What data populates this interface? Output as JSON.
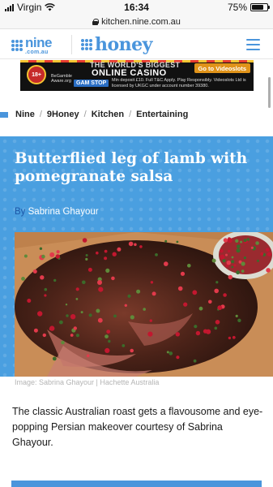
{
  "status_bar": {
    "carrier": "Virgin",
    "time": "16:34",
    "battery_percent": "75%",
    "battery_level": 0.75,
    "icons": [
      "signal-icon",
      "wifi-icon",
      "battery-icon"
    ]
  },
  "browser": {
    "url": "kitchen.nine.com.au",
    "secure": true
  },
  "header": {
    "nine_logo_text": "nine",
    "nine_logo_sub": ".com.au",
    "honey_logo_text": "honey",
    "brand_color": "#4a95dc"
  },
  "ad": {
    "headline_top": "THE WORLD'S BIGGEST",
    "headline_main": "ONLINE CASINO",
    "cta": "Go to Videoslots",
    "badge": "18+",
    "gamble_aware": "BeGamble Aware.org",
    "gamstop": "GAM STOP",
    "fine_print": "Min deposit £10. Full T&C Apply. Play Responsibly. Videoslots Ltd is licensed by UKGC under account number 39380."
  },
  "breadcrumb": {
    "items": [
      "Nine",
      "9Honey",
      "Kitchen",
      "Entertaining"
    ],
    "separator": "/"
  },
  "article": {
    "title": "Butterflied leg of lamb with pomegranate salsa",
    "by_label": "By",
    "author": "Sabrina Ghayour",
    "image_caption": "Image: Sabrina Ghayour | Hachette Australia",
    "intro": "The classic Australian roast gets a flavousome and eye-popping Persian makeover courtesy of Sabrina Ghayour.",
    "hero_color": "#4a9fe0"
  }
}
